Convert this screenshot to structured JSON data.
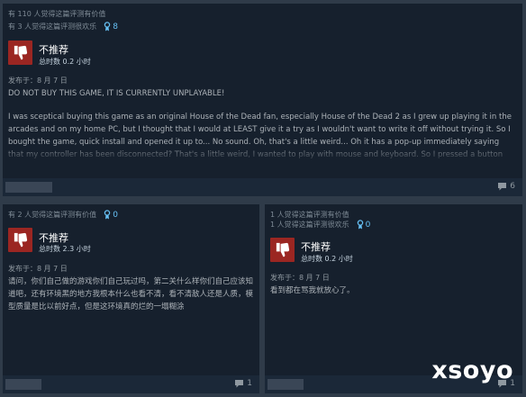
{
  "reviews": [
    {
      "helpful_text": "有 110 人觉得这篇评测有价值",
      "funny_text": "有 3 人觉得这篇评测很欢乐",
      "award_count": "8",
      "verdict": "不推荐",
      "hours": "总时数 0.2 小时",
      "posted": "发布于：8 月 7 日",
      "heading": "DO NOT BUY THIS GAME, IT IS CURRENTLY UNPLAYABLE!",
      "body": "I was sceptical buying this game as an original House of the Dead fan, especially House of the Dead 2 as I grew up playing it in the arcades and on my home PC, but I thought that I would at LEAST give it a try as I wouldn't want to write it off without trying it. So I bought the game, quick install and opened it up to... No sound. Oh, that's a little weird... Oh it has a pop-up immediately saying that my controller has been disconnected? That's a little weird, I wanted to play with mouse and keyboard. So I pressed a button which removed the prompt and",
      "comments": "6"
    },
    {
      "helpful_text": "有 2 人觉得这篇评测有价值",
      "award_count": "0",
      "verdict": "不推荐",
      "hours": "总时数 2.3 小时",
      "posted": "发布于：8 月 7 日",
      "body": "请问，你们自己做的游戏你们自己玩过吗，第二关什么样你们自己应该知道吧，还有环境黑的地方我根本什么也看不清，看不清敌人还是人质，模型质量是比以前好点，但是这环境真的烂的一塌糊涂",
      "comments": "1"
    },
    {
      "helpful_text": "1 人觉得这篇评测有价值",
      "funny_text": "1 人觉得这篇评测很欢乐",
      "award_count": "0",
      "verdict": "不推荐",
      "hours": "总时数 0.2 小时",
      "posted": "发布于：8 月 7 日",
      "body": "看到都在骂我就放心了。",
      "comments": "1"
    }
  ],
  "watermark": "xsoyo",
  "icons": {
    "thumb": "thumbs-down-icon",
    "award": "award-ribbon-icon",
    "comment": "comment-bubble-icon"
  },
  "colors": {
    "page_bg": "#2f3b49",
    "card_bg": "#16202d",
    "thumb_bg": "#9b2622",
    "award": "#66c0f4"
  }
}
